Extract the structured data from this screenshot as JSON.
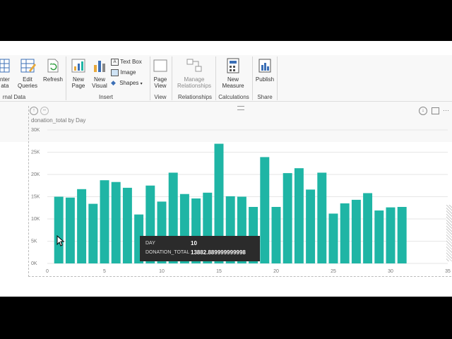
{
  "ribbon": {
    "buttons": {
      "enter_data": "nter\nata",
      "edit_queries": "Edit\nQueries",
      "refresh": "Refresh",
      "new_page": "New\nPage",
      "new_visual": "New\nVisual",
      "text_box": "Text Box",
      "image": "Image",
      "shapes": "Shapes",
      "page_view": "Page\nView",
      "manage_relationships": "Manage\nRelationships",
      "new_measure": "New\nMeasure",
      "publish": "Publish"
    },
    "groups": {
      "external_data": "rnal Data",
      "insert": "Insert",
      "view": "View",
      "relationships": "Relationships",
      "calculations": "Calculations",
      "share": "Share"
    }
  },
  "visual": {
    "title": "donation_total by Day"
  },
  "chart_data": {
    "type": "bar",
    "title": "donation_total by Day",
    "xlabel": "",
    "ylabel": "",
    "x_ticks": [
      "0",
      "5",
      "10",
      "15",
      "20",
      "25",
      "30",
      "35"
    ],
    "y_ticks": [
      "0K",
      "5K",
      "10K",
      "15K",
      "20K",
      "25K",
      "30K"
    ],
    "xlim": [
      0,
      35
    ],
    "ylim": [
      0,
      30000
    ],
    "grid": true,
    "color": "#1fb5a5",
    "x": [
      1,
      2,
      3,
      4,
      5,
      6,
      7,
      8,
      9,
      10,
      11,
      12,
      13,
      14,
      15,
      16,
      17,
      18,
      19,
      20,
      21,
      22,
      23,
      24,
      25,
      26,
      27,
      28,
      29,
      30,
      31
    ],
    "values": [
      15000,
      14800,
      16700,
      13400,
      18700,
      18300,
      17000,
      11000,
      17500,
      13900,
      20400,
      15600,
      14600,
      15900,
      26900,
      15100,
      15000,
      12700,
      23900,
      12700,
      20300,
      21400,
      16600,
      20400,
      11200,
      13500,
      14300,
      15800,
      11900,
      12600,
      12700
    ]
  },
  "tooltip": {
    "day_label": "DAY",
    "day_value": "10",
    "total_label": "DONATION_TOTAL",
    "total_value": "13882.889999999998"
  }
}
